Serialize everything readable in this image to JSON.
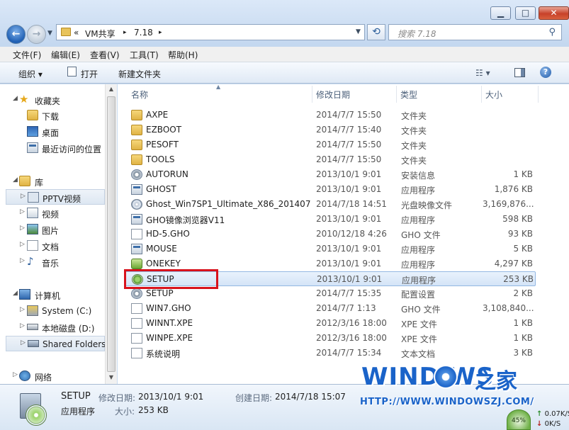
{
  "window": {
    "minimize_icon": "minimize-icon",
    "maximize_icon": "maximize-icon",
    "close_icon": "close-icon"
  },
  "address": {
    "overflow": "«",
    "crumbs": [
      "VM共享",
      "7.18"
    ],
    "separator": "▸"
  },
  "search": {
    "placeholder": "搜索 7.18"
  },
  "menu": [
    "文件(F)",
    "编辑(E)",
    "查看(V)",
    "工具(T)",
    "帮助(H)"
  ],
  "toolbar": {
    "organize": "组织 ▾",
    "open": "打开",
    "new_folder": "新建文件夹",
    "view_icon": "view-options-icon",
    "preview_icon": "preview-pane-icon",
    "help_icon": "help-icon"
  },
  "nav": {
    "favorites": {
      "label": "收藏夹",
      "items": [
        "下载",
        "桌面",
        "最近访问的位置"
      ]
    },
    "libraries": {
      "label": "库",
      "items": [
        "PPTV视频",
        "视频",
        "图片",
        "文档",
        "音乐"
      ]
    },
    "computer": {
      "label": "计算机",
      "items": [
        "System (C:)",
        "本地磁盘 (D:)",
        "Shared Folders"
      ]
    },
    "network": {
      "label": "网络"
    }
  },
  "columns": {
    "name": "名称",
    "date": "修改日期",
    "type": "类型",
    "size": "大小"
  },
  "files": [
    {
      "name": "AXPE",
      "date": "2014/7/7 15:50",
      "type": "文件夹",
      "size": "",
      "icon": "folder"
    },
    {
      "name": "EZBOOT",
      "date": "2014/7/7 15:40",
      "type": "文件夹",
      "size": "",
      "icon": "folder"
    },
    {
      "name": "PESOFT",
      "date": "2014/7/7 15:50",
      "type": "文件夹",
      "size": "",
      "icon": "folder"
    },
    {
      "name": "TOOLS",
      "date": "2014/7/7 15:50",
      "type": "文件夹",
      "size": "",
      "icon": "folder"
    },
    {
      "name": "AUTORUN",
      "date": "2013/10/1 9:01",
      "type": "安装信息",
      "size": "1 KB",
      "icon": "settings"
    },
    {
      "name": "GHOST",
      "date": "2013/10/1 9:01",
      "type": "应用程序",
      "size": "1,876 KB",
      "icon": "app"
    },
    {
      "name": "Ghost_Win7SP1_Ultimate_X86_201407",
      "date": "2014/7/18 14:51",
      "type": "光盘映像文件",
      "size": "3,169,876...",
      "icon": "disc"
    },
    {
      "name": "GHO镜像浏览器V11",
      "date": "2013/10/1 9:01",
      "type": "应用程序",
      "size": "598 KB",
      "icon": "app"
    },
    {
      "name": "HD-5.GHO",
      "date": "2010/12/18 4:26",
      "type": "GHO 文件",
      "size": "93 KB",
      "icon": "doc"
    },
    {
      "name": "MOUSE",
      "date": "2013/10/1 9:01",
      "type": "应用程序",
      "size": "5 KB",
      "icon": "app"
    },
    {
      "name": "ONEKEY",
      "date": "2013/10/1 9:01",
      "type": "应用程序",
      "size": "4,297 KB",
      "icon": "onekey"
    },
    {
      "name": "SETUP",
      "date": "2013/10/1 9:01",
      "type": "应用程序",
      "size": "253 KB",
      "icon": "setup",
      "selected": true
    },
    {
      "name": "SETUP",
      "date": "2014/7/7 15:35",
      "type": "配置设置",
      "size": "2 KB",
      "icon": "settings"
    },
    {
      "name": "WIN7.GHO",
      "date": "2014/7/7 1:13",
      "type": "GHO 文件",
      "size": "3,108,840...",
      "icon": "doc"
    },
    {
      "name": "WINNT.XPE",
      "date": "2012/3/16 18:00",
      "type": "XPE 文件",
      "size": "1 KB",
      "icon": "doc"
    },
    {
      "name": "WINPE.XPE",
      "date": "2012/3/16 18:00",
      "type": "XPE 文件",
      "size": "1 KB",
      "icon": "doc"
    },
    {
      "name": "系统说明",
      "date": "2014/7/7 15:34",
      "type": "文本文档",
      "size": "3 KB",
      "icon": "doc"
    }
  ],
  "details": {
    "name": "SETUP",
    "type": "应用程序",
    "modified_label": "修改日期:",
    "modified": "2013/10/1 9:01",
    "size_label": "大小:",
    "size": "253 KB",
    "created_label": "创建日期:",
    "created": "2014/7/18 15:07"
  },
  "watermark": {
    "brand": "WIND   WS",
    "brand_cn": "之家",
    "url": "HTTP://WWW.WINDOWSZJ.COM/"
  },
  "speed": {
    "percent": "45%",
    "up": "0.07K/S",
    "down": "0K/S",
    "up_arrow": "↑",
    "down_arrow": "↓"
  },
  "colors": {
    "accent": "#1a63c9",
    "highlight_box": "#d8121c",
    "selection": "#d4e4f7"
  }
}
